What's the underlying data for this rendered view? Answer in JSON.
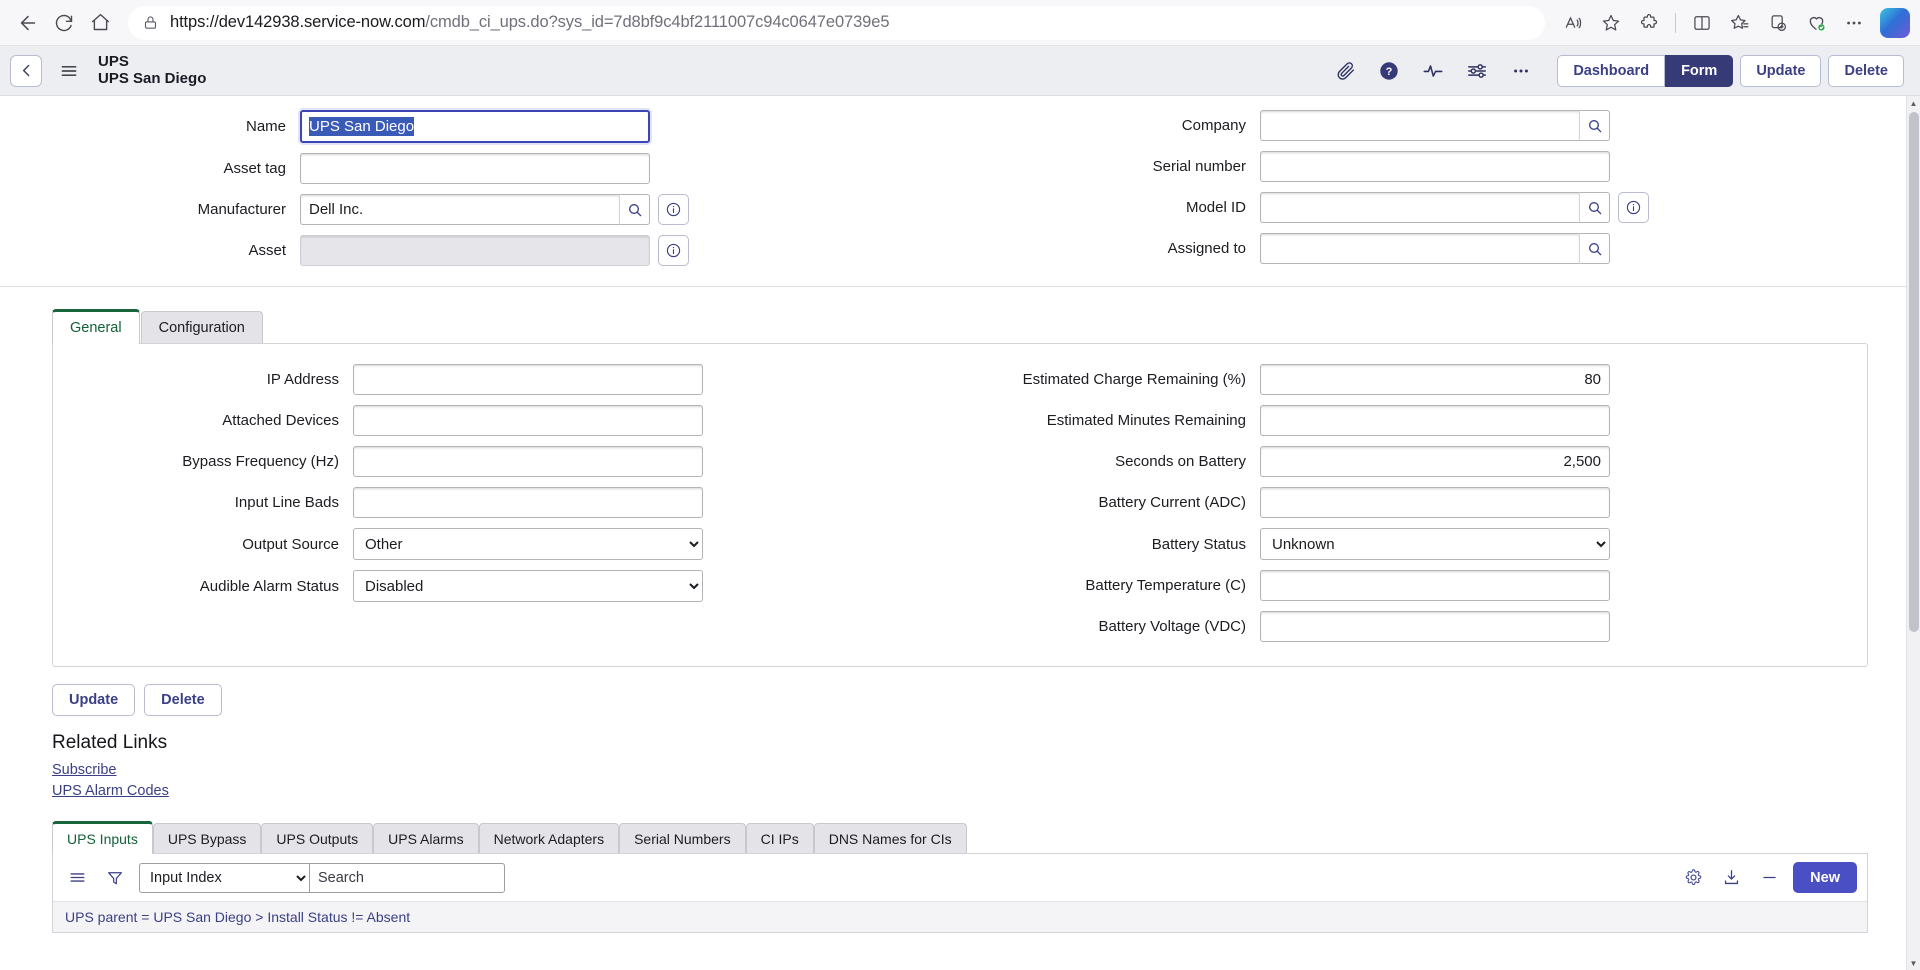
{
  "browser": {
    "url_prefix": "https://dev142938.service-now.com",
    "url_path": "/cmdb_ci_ups.do?sys_id=7d8bf9c4bf2111007c94c0647e0739e5",
    "back_icon": "back-arrow-icon",
    "reload_icon": "reload-icon",
    "home_icon": "home-icon",
    "lock_icon": "lock-icon",
    "read_aloud_icon": "read-aloud-icon",
    "favorite_icon": "star-icon",
    "extensions_icon": "extensions-icon",
    "split_screen_icon": "split-screen-icon",
    "collections_icon": "collections-icon",
    "add_tab_icon": "add-tab-icon",
    "browser_essentials_icon": "browser-essentials-icon",
    "settings_more_icon": "more-options-icon",
    "copilot_icon": "copilot-icon"
  },
  "header": {
    "back_icon": "chevron-left-icon",
    "menu_icon": "hamburger-menu-icon",
    "table_label": "UPS",
    "record_label": "UPS San Diego",
    "icons": [
      {
        "name": "attachment-icon"
      },
      {
        "name": "help-icon"
      },
      {
        "name": "activity-icon"
      },
      {
        "name": "personalize-form-icon"
      },
      {
        "name": "more-options-icon"
      }
    ],
    "buttons": {
      "dashboard": "Dashboard",
      "form": "Form",
      "update": "Update",
      "delete": "Delete"
    }
  },
  "top_form": {
    "left": [
      {
        "label": "Name",
        "value": "UPS San Diego",
        "type": "text",
        "focused": true,
        "selected": true
      },
      {
        "label": "Asset tag",
        "value": "",
        "type": "text"
      },
      {
        "label": "Manufacturer",
        "value": "Dell Inc.",
        "type": "reference",
        "info": true
      },
      {
        "label": "Asset",
        "value": "",
        "type": "readonly",
        "info": true
      }
    ],
    "right": [
      {
        "label": "Company",
        "value": "",
        "type": "reference"
      },
      {
        "label": "Serial number",
        "value": "",
        "type": "text"
      },
      {
        "label": "Model ID",
        "value": "",
        "type": "reference",
        "info": true
      },
      {
        "label": "Assigned to",
        "value": "",
        "type": "reference"
      }
    ]
  },
  "form_tabs": [
    {
      "label": "General",
      "active": true
    },
    {
      "label": "Configuration",
      "active": false
    }
  ],
  "general_tab": {
    "left": [
      {
        "label": "IP Address",
        "value": "",
        "type": "text"
      },
      {
        "label": "Attached Devices",
        "value": "",
        "type": "text"
      },
      {
        "label": "Bypass Frequency (Hz)",
        "value": "",
        "type": "text"
      },
      {
        "label": "Input Line Bads",
        "value": "",
        "type": "text"
      },
      {
        "label": "Output Source",
        "value": "Other",
        "type": "select",
        "options": [
          "Other"
        ]
      },
      {
        "label": "Audible Alarm Status",
        "value": "Disabled",
        "type": "select",
        "options": [
          "Disabled"
        ]
      }
    ],
    "right": [
      {
        "label": "Estimated Charge Remaining (%)",
        "value": "80",
        "type": "number"
      },
      {
        "label": "Estimated Minutes Remaining",
        "value": "",
        "type": "number"
      },
      {
        "label": "Seconds on Battery",
        "value": "2,500",
        "type": "number"
      },
      {
        "label": "Battery Current (ADC)",
        "value": "",
        "type": "number"
      },
      {
        "label": "Battery Status",
        "value": "Unknown",
        "type": "select",
        "options": [
          "Unknown"
        ]
      },
      {
        "label": "Battery Temperature (C)",
        "value": "",
        "type": "number"
      },
      {
        "label": "Battery Voltage (VDC)",
        "value": "",
        "type": "number"
      }
    ]
  },
  "actions": {
    "update": "Update",
    "delete": "Delete"
  },
  "related_links": {
    "title": "Related Links",
    "links": [
      "Subscribe",
      "UPS Alarm Codes"
    ]
  },
  "related_lists": {
    "tabs": [
      {
        "label": "UPS Inputs",
        "active": true
      },
      {
        "label": "UPS Bypass",
        "active": false
      },
      {
        "label": "UPS Outputs",
        "active": false
      },
      {
        "label": "UPS Alarms",
        "active": false
      },
      {
        "label": "Network Adapters",
        "active": false
      },
      {
        "label": "Serial Numbers",
        "active": false
      },
      {
        "label": "CI IPs",
        "active": false
      },
      {
        "label": "DNS Names for CIs",
        "active": false
      }
    ],
    "toolbar": {
      "list_menu_icon": "list-menu-icon",
      "filter_icon": "funnel-filter-icon",
      "field_select": "Input Index",
      "search_placeholder": "Search",
      "search_value": "",
      "settings_icon": "gear-icon",
      "export_icon": "download-icon",
      "collapse_icon": "collapse-icon",
      "new_label": "New"
    },
    "breadcrumb": "UPS parent = UPS San Diego > Install Status != Absent"
  },
  "scrollbar": {
    "up_icon": "scroll-up-icon",
    "down_icon": "scroll-down-icon"
  },
  "colors": {
    "accent": "#363a77",
    "link": "#3b3f85",
    "active_tab": "#17643d",
    "new_button": "#4a4fc4",
    "selection": "#3a5ab8"
  }
}
